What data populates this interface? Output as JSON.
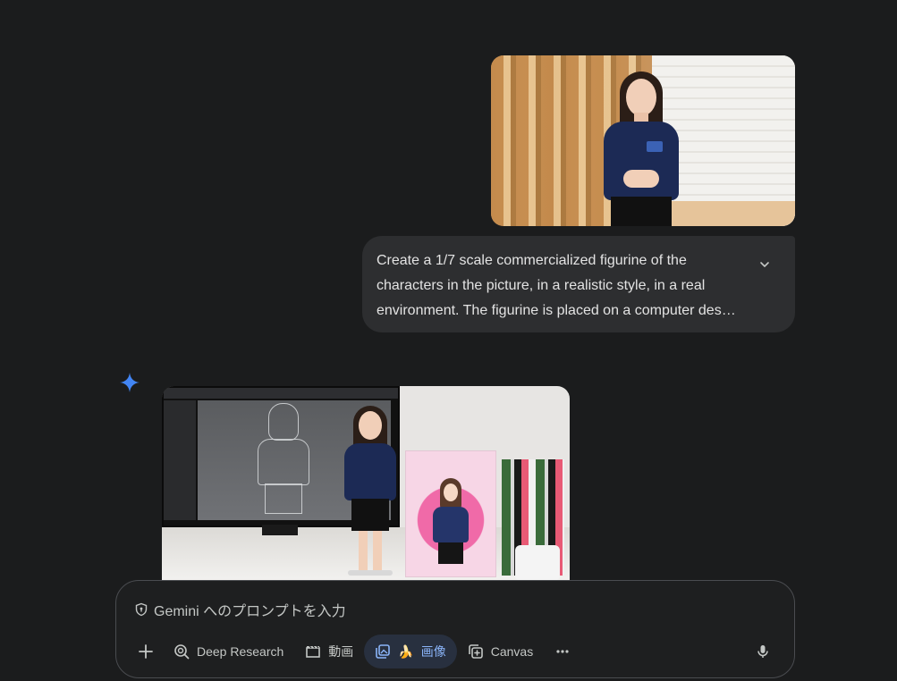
{
  "conversation": {
    "user_prompt": "Create a 1/7 scale commercialized figurine of the characters in the picture, in a realistic style, in a real environment. The figurine is placed on a computer des…",
    "expand_icon": "chevron-down-icon"
  },
  "composer": {
    "placeholder": "Gemini へのプロンプトを入力",
    "tools": {
      "deep_research": "Deep Research",
      "video": "動画",
      "image": "画像",
      "canvas": "Canvas"
    }
  },
  "colors": {
    "background": "#1b1c1d",
    "bubble": "#2d2e30",
    "active_tool_text": "#8ab4f8",
    "gemini_blue": "#4285f4"
  }
}
